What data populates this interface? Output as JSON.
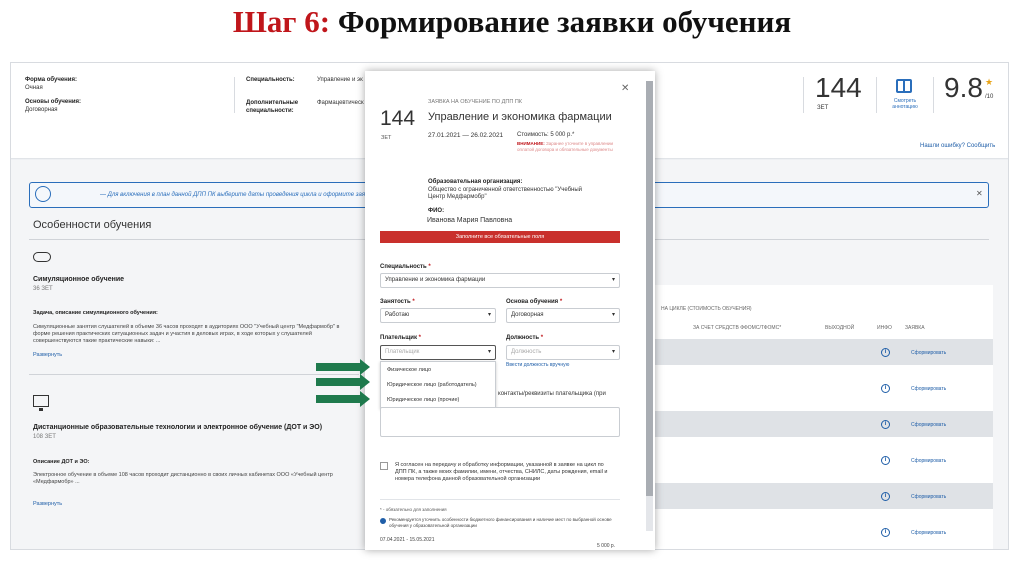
{
  "slide": {
    "step": "Шаг 6:",
    "title": " Формирование заявки обучения"
  },
  "page": {
    "form_label": "Форма обучения:",
    "form_value": "Очная",
    "basis_label": "Основы обучения:",
    "basis_value": "Договорная",
    "spec_label": "Специальность:",
    "spec_value": "Управление и эк",
    "add_spec_label": "Дополнительные специальности:",
    "add_spec_value": "Фармацевтическ",
    "zet_value": "144",
    "zet_label": "ЗЕТ",
    "annot_label": "Смотреть аннотацию",
    "rating_value": "9.8",
    "rating_max": "/10",
    "rating_star": "★",
    "error_link": "Нашли ошибку? Сообщить",
    "notice_text": "— Для включения в план данной ДПП ПК выберите даты проведения цикла и оформите заявк",
    "notice_close": "✕",
    "features_title": "Особенности обучения",
    "sim_title": "Симуляционное обучение",
    "sim_zet": "36 ЗЕТ",
    "sim_desc_h": "Задача, описание симуляционного обучения:",
    "sim_desc": "Симуляционные занятия слушателей в объеме 36 часов проходят в аудиториях ООО \"Учебный центр \"Медфармобр\" в форме решения практических ситуационных задач и участия в деловых играх, в ходе которых у слушателей совершенствуются такие практические навыки: ...",
    "expand_1": "Развернуть",
    "dot_title": "Дистанционные образовательные технологии и электронное обучение (ДОТ и ЭО)",
    "dot_zet": "108 ЗЕТ",
    "dot_desc_h": "Описание ДОТ и ЭО:",
    "dot_desc": "Электронное обучение в объеме 108 часов проходит дистанционно в своих личных кабинетах ООО «Учебный центр «Медфармобр» ...",
    "expand_2": "Развернуть",
    "table_header_group": "НА ЦИКЛЕ (СТОИМОСТЬ ОБУЧЕНИЯ)",
    "col_ffoms": "ЗА СЧЕТ СРЕДСТВ ФФОМС/ТФОМС*",
    "col_day": "ВЫХОДНОЙ",
    "col_info": "ИНФО",
    "col_app": "ЗАЯВКА",
    "row_action": "Сформировать",
    "under_dates": "07.04.2021 - 15.05.2021",
    "under_price": "5 000 р."
  },
  "modal": {
    "close": "✕",
    "kicker": "ЗАЯВКА НА ОБУЧЕНИЕ ПО ДПП ПК",
    "zet": "144",
    "zet_label": "ЗЕТ",
    "title": "Управление и экономика фармации",
    "dates": "27.01.2021 — 26.02.2021",
    "cost": "Стоимость: 5 000 р.*",
    "warn_head": "ВНИМАНИЕ:",
    "warn_text": "Заранее уточните в управлении оплатой договора и обязательные документы",
    "org_label": "Образовательная организация:",
    "org_value": "Общество с ограниченной ответственностью \"Учебный Центр Медфармобр\"",
    "fio_label": "ФИО:",
    "fio_value": "Иванова Мария Павловна",
    "alert": "Заполните все обязательные поля",
    "spec_label": "Специальность",
    "spec_value": "Управление и экономика фармации",
    "busy_label": "Занятость",
    "busy_value": "Работаю",
    "basis_label": "Основа обучения",
    "basis_value": "Договорная",
    "payer_label": "Плательщик",
    "payer_placeholder": "Плательщик",
    "position_label": "Должность",
    "position_placeholder": "Должность",
    "position_manual": "Ввести должность вручную",
    "payer_options": [
      "Физическое лицо",
      "Юридическое лицо (работодатель)",
      "Юридическое лицо (прочие)"
    ],
    "contacts_label": "контакты/реквизиты плательщика (при",
    "consent": "Я согласен на передачу и обработку информации, указанной в заявке на цикл по ДПП ПК, а также моих фамилии, имени, отчества, СНИЛС, даты рождения, email и номера телефона данной образовательной организации",
    "req_note": "* - обязательно для заполнения",
    "info_note": "Рекомендуется уточнить особенности бюджетного финансирования и наличие мест по выбранной основе обучения у образовательной организации",
    "req_star": "*",
    "chevron": "▾"
  },
  "colors": {
    "accent": "#c0161b",
    "blue": "#1f5ea8",
    "arrow_green": "#1f7a4d",
    "alert_red": "#c9302c"
  }
}
